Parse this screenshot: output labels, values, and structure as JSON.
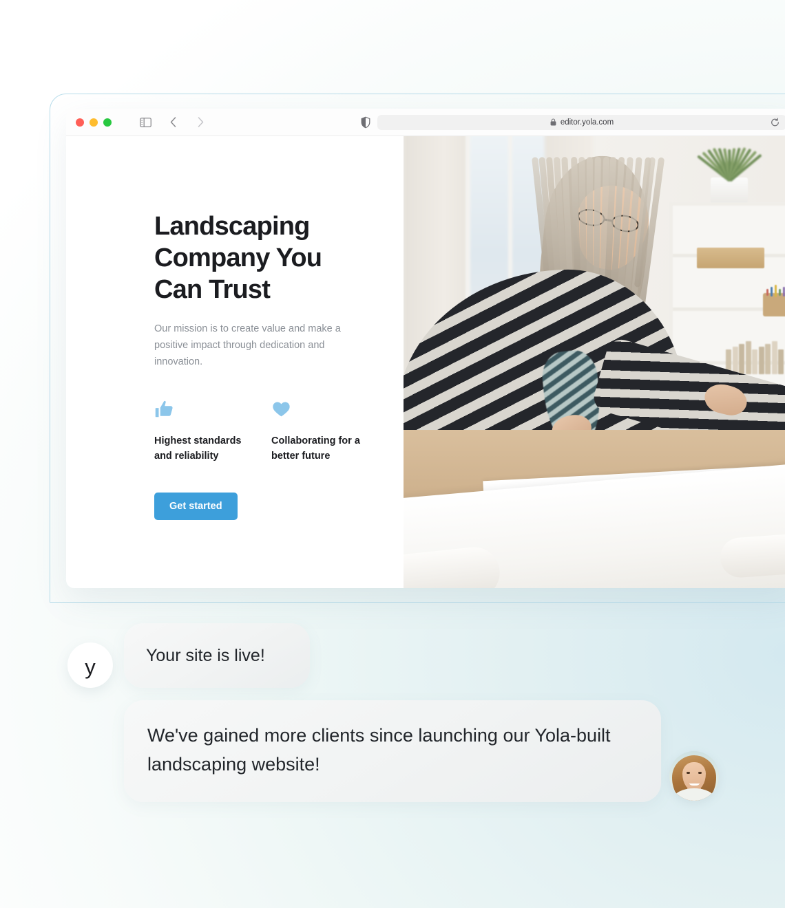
{
  "background": {
    "accent_blue": "#3d9fdb",
    "frame_border": "#b7dcea",
    "gradient_from": "#ffffff",
    "gradient_to": "#d4e9f0"
  },
  "browser": {
    "traffic_lights": [
      {
        "name": "close",
        "color": "#ff5f57"
      },
      {
        "name": "minimize",
        "color": "#febc2e"
      },
      {
        "name": "maximize",
        "color": "#28c840"
      }
    ],
    "sidebar_toggle_icon": "sidebar-icon",
    "back_icon": "chevron-left-icon",
    "forward_icon": "chevron-right-icon",
    "shield_icon": "shield-icon",
    "lock_icon": "lock-icon",
    "reload_icon": "reload-icon",
    "url": "editor.yola.com"
  },
  "site": {
    "headline": "Landscaping Company You Can Trust",
    "subcopy": "Our mission is to create value and make a positive impact through dedication and innovation.",
    "features": [
      {
        "icon": "thumbs-up-icon",
        "label": "Highest standards and reliability",
        "color": "#8cc6ea"
      },
      {
        "icon": "heart-icon",
        "label": "Collaborating for a better future",
        "color": "#8cc6ea"
      }
    ],
    "cta_label": "Get started",
    "hero_image_alt": "Woman with gray hair and glasses in striped sweater leaning over architectural blueprints on a desk"
  },
  "chat": {
    "brand_avatar_letter": "y",
    "messages": [
      {
        "text": "Your site is live!",
        "from": "brand"
      },
      {
        "text": "We've gained more clients since launching our Yola-built landscaping website!",
        "from": "customer"
      }
    ],
    "customer_avatar_alt": "Smiling woman with long light brown hair"
  }
}
